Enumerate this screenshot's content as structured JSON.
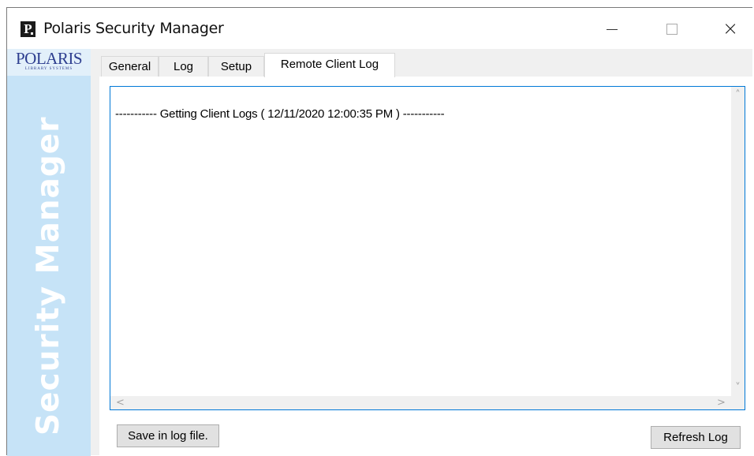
{
  "window": {
    "title": "Polaris Security Manager",
    "app_icon_letter": "P",
    "controls": {
      "minimize": "minimize",
      "maximize": "maximize",
      "close": "×"
    }
  },
  "sidebar": {
    "logo_text": "POLARIS",
    "logo_subtext": "LIBRARY SYSTEMS",
    "vertical_label": "Security Manager"
  },
  "tabs": [
    {
      "label": "General",
      "active": false
    },
    {
      "label": "Log",
      "active": false
    },
    {
      "label": "Setup",
      "active": false
    },
    {
      "label": "Remote Client Log",
      "active": true
    }
  ],
  "remote_client_log": {
    "log_text": "----------- Getting Client Logs ( 12/11/2020 12:00:35 PM ) -----------",
    "save_button": "Save in log file.",
    "refresh_button": "Refresh Log"
  },
  "colors": {
    "sidebar_bg": "#c6e3f7",
    "logo_color": "#2d3e8f",
    "focus_border": "#0078d7"
  }
}
